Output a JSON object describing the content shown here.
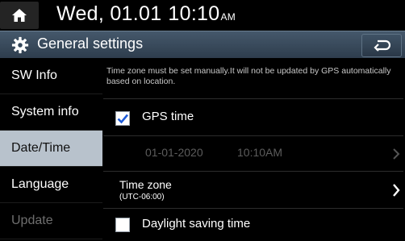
{
  "status": {
    "date": "Wed, 01.01",
    "time": "10:10",
    "ampm": "AM"
  },
  "header": {
    "title": "General settings"
  },
  "sidebar": {
    "items": [
      {
        "label": "SW Info"
      },
      {
        "label": "System info"
      },
      {
        "label": "Date/Time"
      },
      {
        "label": "Language"
      },
      {
        "label": "Update"
      }
    ],
    "active_index": 2
  },
  "main": {
    "notice": "Time zone must be set manually.It will not be updated by GPS automatically based on location.",
    "gps_time": {
      "label": "GPS time",
      "checked": true
    },
    "datetime_row": {
      "date": "01-01-2020",
      "time": "10:10AM"
    },
    "time_zone": {
      "label": "Time zone",
      "value": "(UTC-06:00)"
    },
    "daylight_saving": {
      "label": "Daylight saving time",
      "checked": false
    }
  },
  "icons": {
    "home": "home-icon",
    "settings": "gear-icon",
    "back": "back-arrow-icon",
    "chevron": "chevron-right-icon",
    "check": "check-icon"
  },
  "colors": {
    "header_gradient_top": "#45586b",
    "header_gradient_bottom": "#2e3d4d",
    "active_tab": "#b8c2cc",
    "check_blue": "#1e5bd8",
    "disabled_text": "#6e6e6e"
  }
}
